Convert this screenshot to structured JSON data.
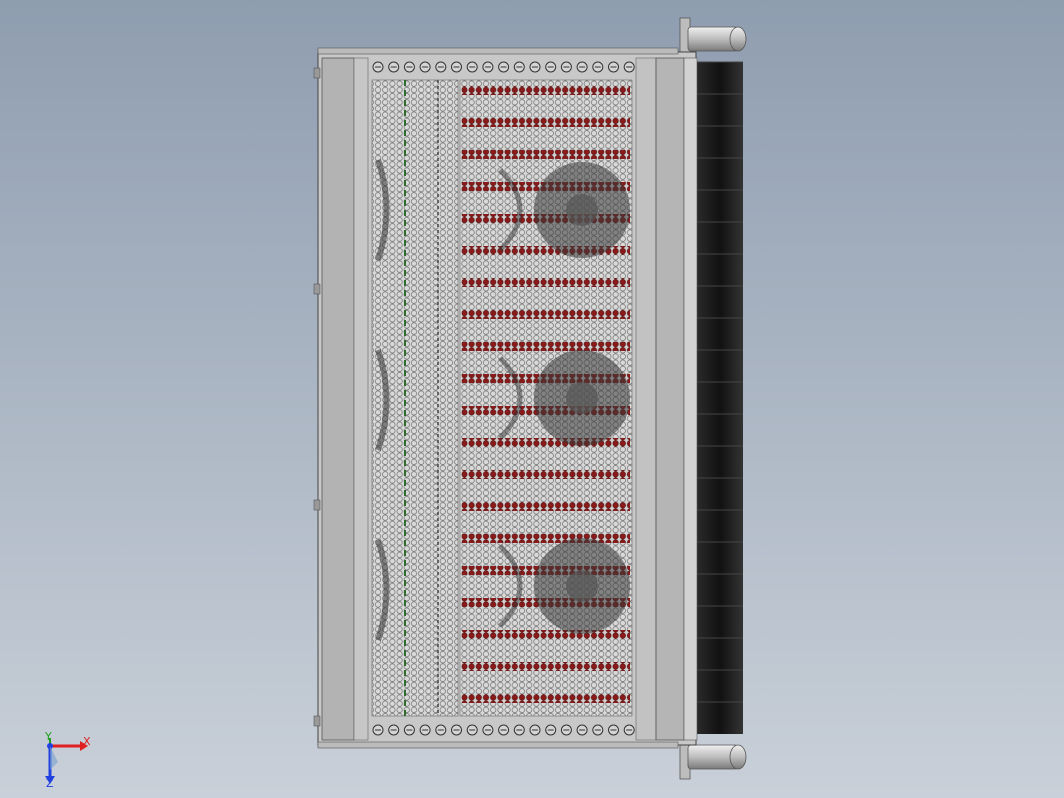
{
  "view": {
    "background_top": "#8f9db0",
    "background_bottom": "#c9d0d9"
  },
  "model": {
    "frame_color": "#c8c8c8",
    "panel_color": "#b8b8b8",
    "mesh_color": "#9a9a9a",
    "heat_color": "#8b1a1a",
    "fan_count": 3,
    "fin_color": "#1a1a1a"
  },
  "triad": {
    "x_label": "X",
    "y_label": "Y",
    "z_label": "Z",
    "x_color": "#e02020",
    "y_color": "#20a020",
    "z_color": "#2040e0"
  }
}
